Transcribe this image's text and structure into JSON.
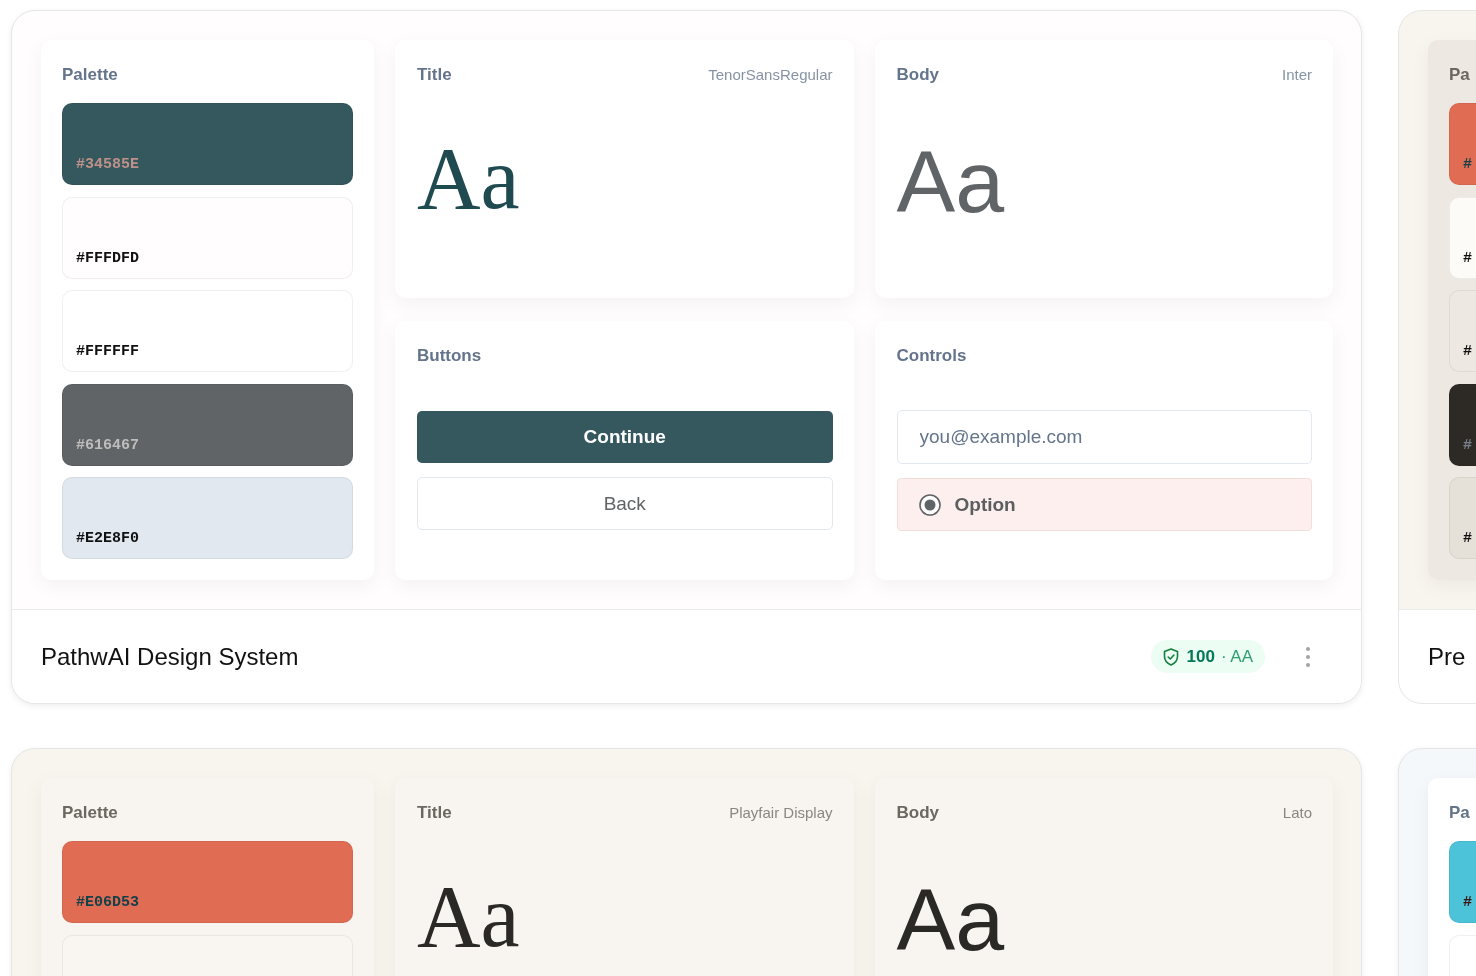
{
  "cards": [
    {
      "kind": "white",
      "palette": {
        "heading": "Palette",
        "swatches": [
          {
            "label": "#34585E",
            "color": "#34585e"
          },
          {
            "label": "#FFFDFD",
            "color": "#fffdfd"
          },
          {
            "label": "#FFFFFF",
            "color": "#ffffff"
          },
          {
            "label": "#616467",
            "color": "#616467"
          },
          {
            "label": "#E2E8F0",
            "color": "#e2e8f0"
          }
        ]
      },
      "title_type": {
        "heading": "Title",
        "font": "TenorSansRegular",
        "sample": "Aa",
        "color": "#1e4a50"
      },
      "body_type": {
        "heading": "Body",
        "font": "Inter",
        "sample": "Aa",
        "color": "#616467"
      },
      "buttons": {
        "heading": "Buttons",
        "items": [
          {
            "label": "Continue",
            "kind": "primary"
          },
          {
            "label": "Back",
            "kind": "secondary"
          }
        ]
      },
      "controls": {
        "heading": "Controls",
        "email": {
          "placeholder": "you@example.com"
        },
        "option": {
          "label": "Option",
          "selected": true
        }
      },
      "footer": {
        "name": "PathwAI Design System",
        "score": "100",
        "grade": "· AA",
        "menu_button": true
      }
    },
    {
      "kind": "sand",
      "palette": {
        "heading": "Pa",
        "swatches": [
          {
            "label": "#",
            "color": "#e06d53"
          },
          {
            "label": "#",
            "color": "#fdfbf7"
          },
          {
            "label": "#",
            "color": "#ede8e1"
          },
          {
            "label": "#",
            "color": "#2d2a26"
          },
          {
            "label": "#",
            "color": "#e6e1d8"
          }
        ]
      },
      "footer": {
        "name": "Pre"
      }
    },
    {
      "kind": "cream",
      "palette": {
        "heading": "Palette",
        "swatches": [
          {
            "label": "#E06D53",
            "color": "#e06d53"
          },
          {
            "color": "#f9f6f1"
          }
        ]
      },
      "title_type": {
        "heading": "Title",
        "font": "Playfair Display",
        "sample": "Aa",
        "color": "#2b2925"
      },
      "body_type": {
        "heading": "Body",
        "font": "Lato",
        "sample": "Aa",
        "color": "#2b2925"
      }
    },
    {
      "kind": "frost",
      "palette": {
        "heading": "Pa",
        "swatches": [
          {
            "label": "#",
            "color": "#4cc3d9"
          },
          {
            "color": "#ffffff"
          }
        ]
      }
    }
  ]
}
